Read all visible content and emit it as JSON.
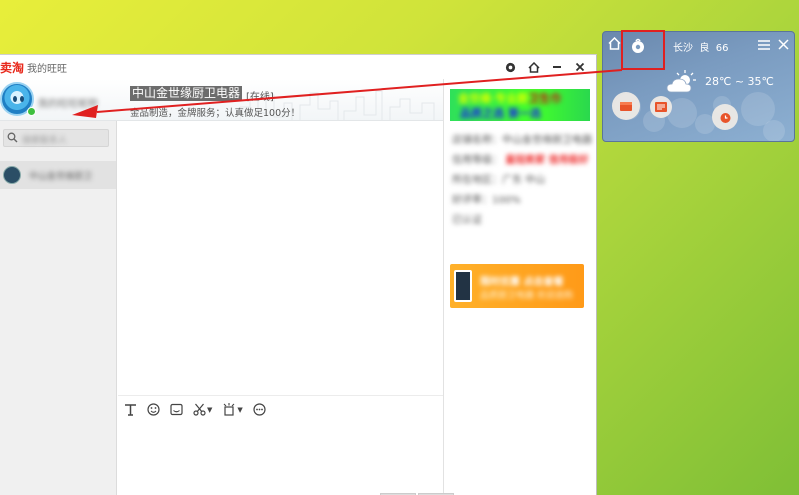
{
  "titlebar": {
    "brand": "卖淘",
    "subtitle": "我的旺旺"
  },
  "me": {
    "name": "我的旺旺昵称"
  },
  "search": {
    "placeholder": "搜索联系人"
  },
  "contacts": [
    {
      "name": "中山金世缘厨卫"
    }
  ],
  "shop": {
    "name": "中山金世缘厨卫电器",
    "status": "[在线]",
    "slogan": "金品制造，金牌服务；认真做足100分！"
  },
  "right_panel": {
    "banner_line1_a": "金世缘·专业厨",
    "banner_line1_b": "卫生巾",
    "banner_line2": "品质之选 第一选",
    "info": [
      "店铺名称：中山金世缘厨卫电器",
      "信用等级：",
      "所在地区：广东 中山",
      "好评率：100%",
      "已认证"
    ],
    "credit_tag": "皇冠卖家 信用极好",
    "promo_line1": "限时优惠 点击查看",
    "promo_line2": "品质厨卫电器 欢迎选购"
  },
  "weather": {
    "city": "长沙",
    "aqi_level": "良",
    "aqi_value": "66",
    "temp_range": "28℃ ~ 35℃"
  },
  "colors": {
    "brand_red": "#e8281b",
    "annotation_red": "#e02020",
    "online_green": "#3fbf3f",
    "widget_blue": "#7a9bc0"
  }
}
